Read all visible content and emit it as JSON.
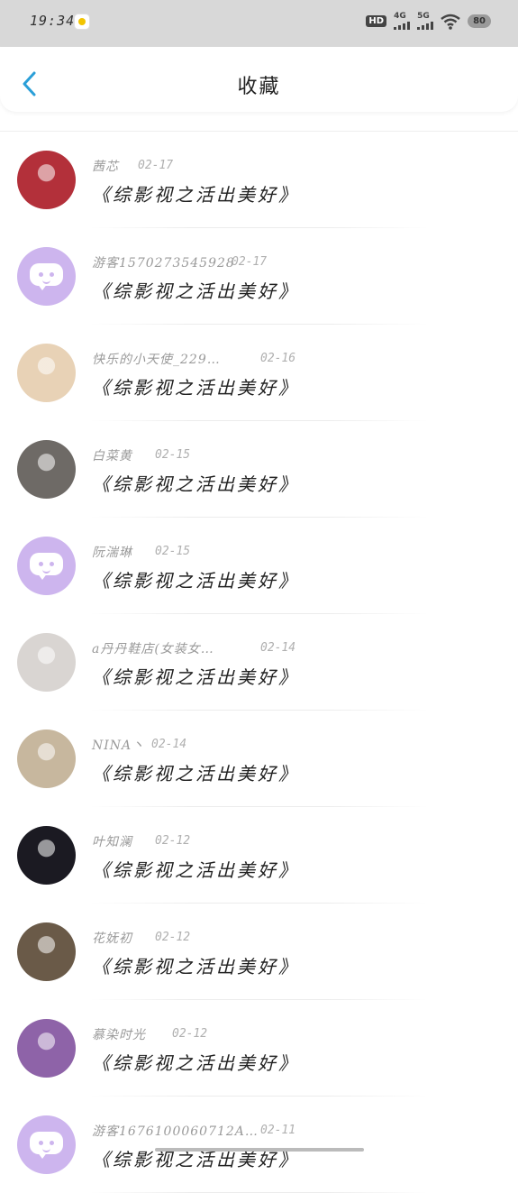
{
  "status_bar": {
    "time": "19:34",
    "hd_label": "HD",
    "net1": "4G",
    "net2": "5G",
    "battery": "80"
  },
  "header": {
    "title": "收藏"
  },
  "items": [
    {
      "name": "茜芯",
      "date": "02-17",
      "book": "《综影视之活出美好》",
      "avatar": "photo",
      "avatar_color": "#b3303a"
    },
    {
      "name": "游客1570273545928",
      "date": "02-17",
      "book": "《综影视之活出美好》",
      "avatar": "guest"
    },
    {
      "name": "快乐的小天使_229…",
      "date": "02-16",
      "book": "《综影视之活出美好》",
      "avatar": "photo",
      "avatar_color": "#e8d2b6"
    },
    {
      "name": "白菜黄",
      "date": "02-15",
      "book": "《综影视之活出美好》",
      "avatar": "photo",
      "avatar_color": "#6e6a66"
    },
    {
      "name": "阮湍琳",
      "date": "02-15",
      "book": "《综影视之活出美好》",
      "avatar": "guest"
    },
    {
      "name": "a丹丹鞋店(女装女…",
      "date": "02-14",
      "book": "《综影视之活出美好》",
      "avatar": "photo",
      "avatar_color": "#d9d5d2"
    },
    {
      "name": "NINA丶",
      "date": "02-14",
      "book": "《综影视之活出美好》",
      "avatar": "photo",
      "avatar_color": "#c7b79e"
    },
    {
      "name": "叶知澜",
      "date": "02-12",
      "book": "《综影视之活出美好》",
      "avatar": "photo",
      "avatar_color": "#1b1a22"
    },
    {
      "name": "花妩初",
      "date": "02-12",
      "book": "《综影视之活出美好》",
      "avatar": "photo",
      "avatar_color": "#6a5a48"
    },
    {
      "name": "慕染时光",
      "date": "02-12",
      "book": "《综影视之活出美好》",
      "avatar": "photo",
      "avatar_color": "#8e63a8"
    },
    {
      "name": "游客1676100060712A…",
      "date": "02-11",
      "book": "《综影视之活出美好》",
      "avatar": "guest"
    }
  ]
}
